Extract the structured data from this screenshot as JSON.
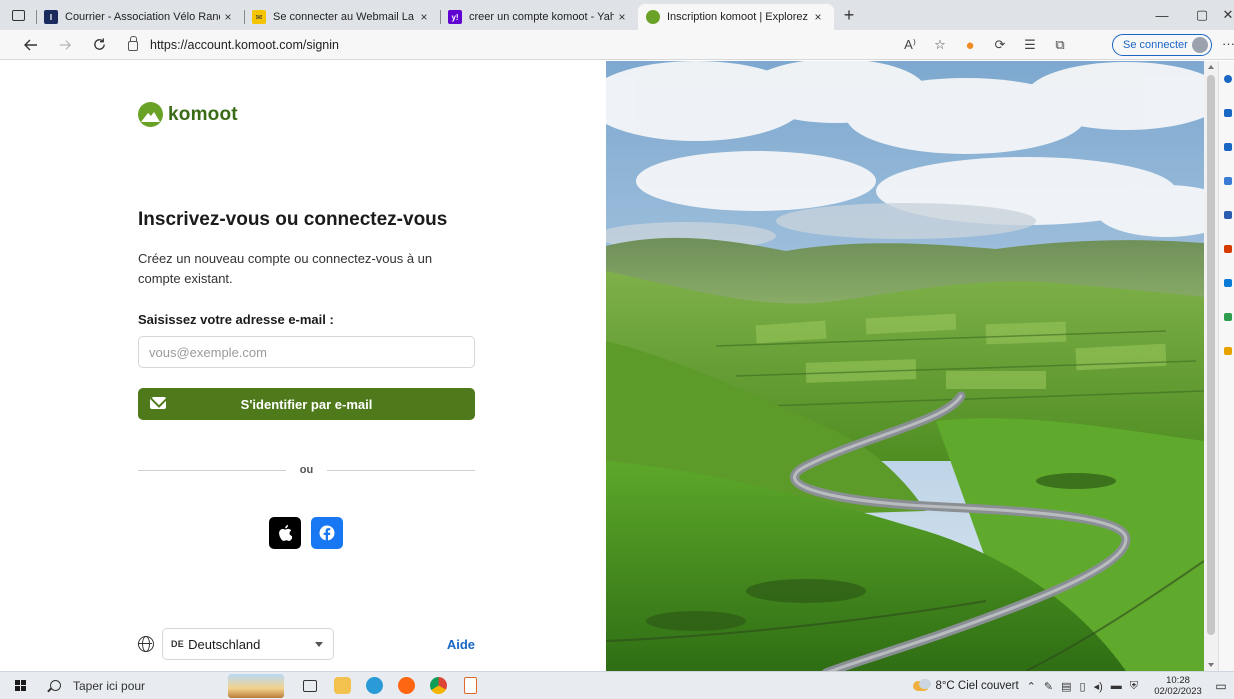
{
  "browser": {
    "tabs": [
      {
        "title": "Courrier - Association Vélo Rand",
        "fav_color": "#1a2a5c",
        "fav_text": "I",
        "active": false
      },
      {
        "title": "Se connecter au Webmail La Pos",
        "fav_color": "#f5c400",
        "fav_text": "✉",
        "active": false
      },
      {
        "title": "creer un compte komoot - Yaho",
        "fav_color": "#5f01d1",
        "fav_text": "y!",
        "active": false
      },
      {
        "title": "Inscription komoot | Explorez un",
        "fav_color": "#6aa127",
        "fav_text": "",
        "active": true
      }
    ],
    "new_tab_label": "+",
    "tab_close_glyph": "×",
    "url": "https://account.komoot.com/signin",
    "read_aloud_label": "A⁾",
    "signin_label": "Se connecter",
    "window_controls": [
      "—",
      "▢",
      "✕"
    ]
  },
  "page": {
    "brand": "komoot",
    "title": "Inscrivez-vous ou connectez-vous",
    "subtitle": "Créez un nouveau compte ou connectez-vous à un compte existant.",
    "email_label": "Saisissez votre adresse e-mail :",
    "email_placeholder": "vous@exemple.com",
    "email_value": "",
    "email_button": "S'identifier par e-mail",
    "or_label": "ou",
    "language_code": "DE",
    "language_name": "Deutschland",
    "help_label": "Aide",
    "colors": {
      "brand_green": "#4f7a1c",
      "link_blue": "#1a66c5",
      "facebook": "#1877f2"
    }
  },
  "taskbar": {
    "search_placeholder": "Taper ici pour",
    "weather": "8°C  Ciel couvert",
    "time": "10:28",
    "date": "02/02/2023"
  }
}
